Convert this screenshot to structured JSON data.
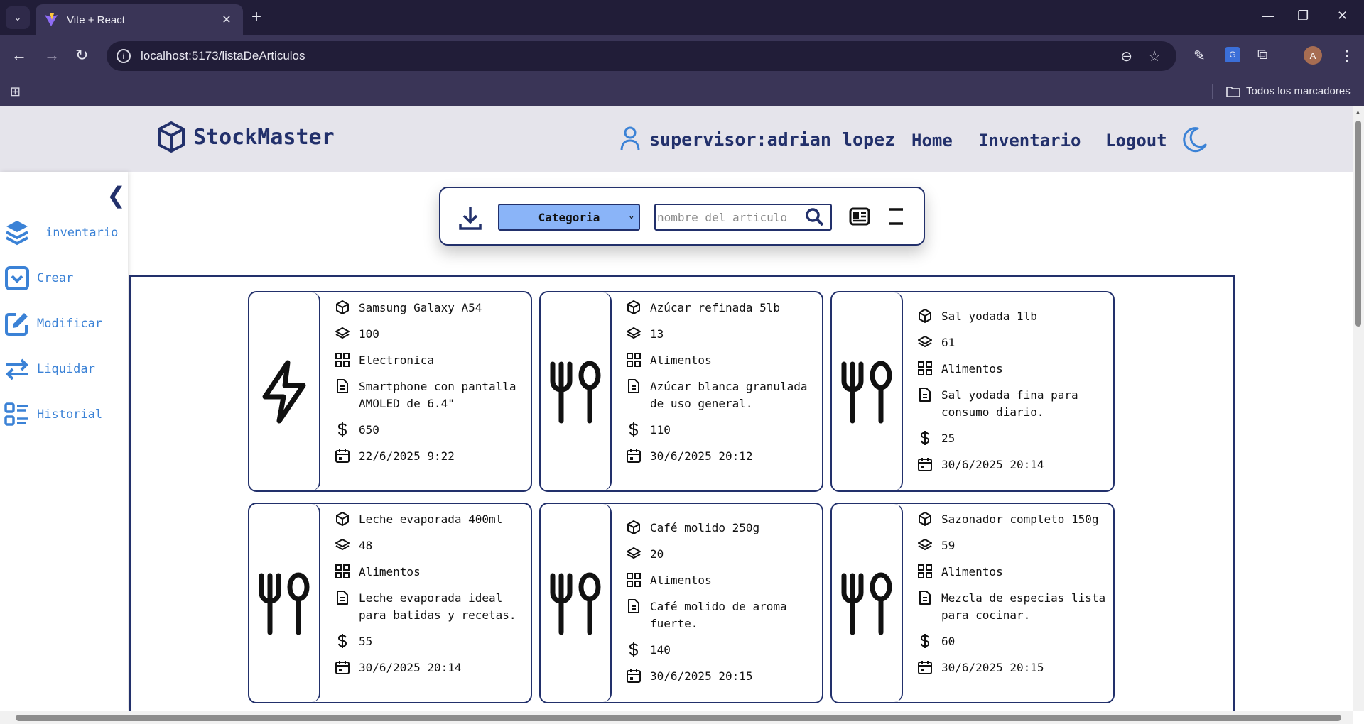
{
  "browser": {
    "tab_title": "Vite + React",
    "url": "localhost:5173/listaDeArticulos",
    "profile_initial": "A",
    "bookmarks_label": "Todos los marcadores"
  },
  "app": {
    "brand": "StockMaster",
    "user": "supervisor:adrian lopez",
    "nav": {
      "home": "Home",
      "inventario": "Inventario",
      "logout": "Logout"
    },
    "colors": {
      "primary": "#22306b",
      "accent": "#3b82d6",
      "select_bg": "#8ab4f8",
      "header_bg": "#e5e4eb"
    }
  },
  "sidebar": {
    "collapse": "❮",
    "items": [
      {
        "label": "inventario",
        "icon": "layers-icon"
      },
      {
        "label": "Crear",
        "icon": "create-icon"
      },
      {
        "label": "Modificar",
        "icon": "edit-icon"
      },
      {
        "label": "Liquidar",
        "icon": "transfer-icon"
      },
      {
        "label": "Historial",
        "icon": "list-icon"
      }
    ]
  },
  "toolbar": {
    "category_selected": "Categoria",
    "search_placeholder": "nombre del articulo"
  },
  "articles": [
    {
      "name": "Samsung Galaxy A54",
      "stock": "100",
      "category": "Electronica",
      "description": "Smartphone con pantalla AMOLED de 6.4\"",
      "price": "650",
      "date": "22/6/2025 9:22",
      "icon": "lightning-icon"
    },
    {
      "name": "Azúcar refinada 5lb",
      "stock": "13",
      "category": "Alimentos",
      "description": "Azúcar blanca granulada de uso general.",
      "price": "110",
      "date": "30/6/2025 20:12",
      "icon": "fork-spoon-icon"
    },
    {
      "name": "Sal yodada 1lb",
      "stock": "61",
      "category": "Alimentos",
      "description": "Sal yodada fina para consumo diario.",
      "price": "25",
      "date": "30/6/2025 20:14",
      "icon": "fork-spoon-icon"
    },
    {
      "name": "Leche evaporada 400ml",
      "stock": "48",
      "category": "Alimentos",
      "description": "Leche evaporada ideal para batidas y recetas.",
      "price": "55",
      "date": "30/6/2025 20:14",
      "icon": "fork-spoon-icon"
    },
    {
      "name": "Café molido 250g",
      "stock": "20",
      "category": "Alimentos",
      "description": "Café molido de aroma fuerte.",
      "price": "140",
      "date": "30/6/2025 20:15",
      "icon": "fork-spoon-icon"
    },
    {
      "name": "Sazonador completo 150g",
      "stock": "59",
      "category": "Alimentos",
      "description": "Mezcla de especias lista para cocinar.",
      "price": "60",
      "date": "30/6/2025 20:15",
      "icon": "fork-spoon-icon"
    }
  ]
}
